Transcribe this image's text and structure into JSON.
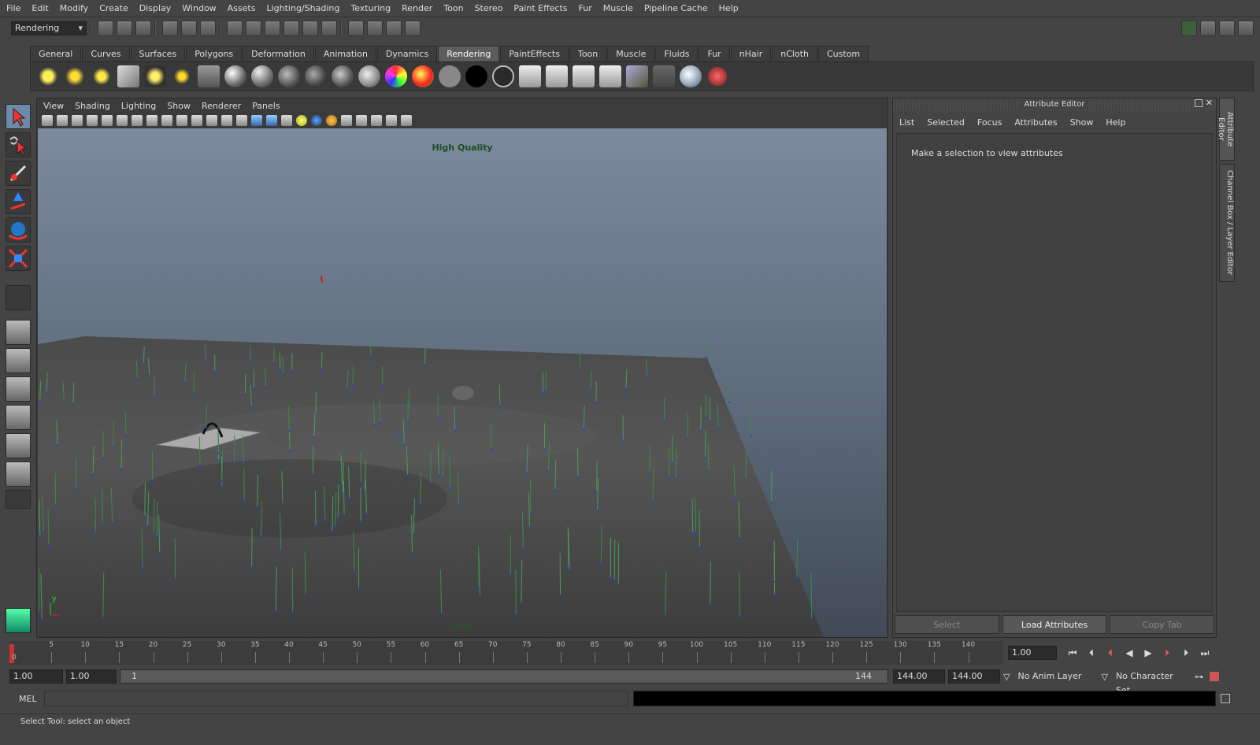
{
  "menubar": {
    "items": [
      "File",
      "Edit",
      "Modify",
      "Create",
      "Display",
      "Window",
      "Assets",
      "Lighting/Shading",
      "Texturing",
      "Render",
      "Toon",
      "Stereo",
      "Paint Effects",
      "Fur",
      "Muscle",
      "Pipeline Cache",
      "Help"
    ]
  },
  "statusline": {
    "mode": "Rendering"
  },
  "shelf": {
    "tabs": [
      "General",
      "Curves",
      "Surfaces",
      "Polygons",
      "Deformation",
      "Animation",
      "Dynamics",
      "Rendering",
      "PaintEffects",
      "Toon",
      "Muscle",
      "Fluids",
      "Fur",
      "nHair",
      "nCloth",
      "Custom"
    ],
    "active_tab": "Rendering"
  },
  "viewport": {
    "menu": [
      "View",
      "Shading",
      "Lighting",
      "Show",
      "Renderer",
      "Panels"
    ],
    "hud_quality": "High Quality",
    "camera_label": "persp",
    "axis_y": "y"
  },
  "attribute_editor": {
    "title": "Attribute Editor",
    "menu": [
      "List",
      "Selected",
      "Focus",
      "Attributes",
      "Show",
      "Help"
    ],
    "message": "Make a selection to view attributes",
    "buttons": {
      "select": "Select",
      "load": "Load Attributes",
      "copy_tab": "Copy Tab"
    }
  },
  "side_tabs": {
    "attr": "Attribute Editor",
    "channel": "Channel Box / Layer Editor"
  },
  "time_slider": {
    "tick_labels": [
      "5",
      "10",
      "15",
      "20",
      "25",
      "30",
      "35",
      "40",
      "45",
      "50",
      "55",
      "60",
      "65",
      "70",
      "75",
      "80",
      "85",
      "90",
      "95",
      "100",
      "105",
      "110",
      "115",
      "120",
      "125",
      "130",
      "135",
      "140"
    ],
    "start_label": "0",
    "current_time": "1.00"
  },
  "range_slider": {
    "start_time": "1.00",
    "playback_start": "1.00",
    "range_start": "1",
    "range_end": "144",
    "playback_end": "144.00",
    "end_time": "144.00",
    "anim_layer": "No Anim Layer",
    "character_set": "No Character Set"
  },
  "command_line": {
    "label": "MEL"
  },
  "help_line": {
    "text": "Select Tool: select an object"
  }
}
